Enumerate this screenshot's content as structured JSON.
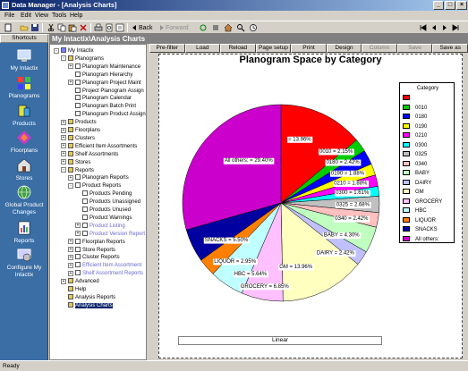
{
  "window": {
    "title": "Data Manager - [Analysis Charts]"
  },
  "menu": [
    "File",
    "Edit",
    "View",
    "Tools",
    "Help"
  ],
  "toolbar": {
    "back_label": "Back",
    "forward_label": "Forward"
  },
  "shortcuts": {
    "header": "Shortcuts",
    "items": [
      {
        "label": "My Intactix",
        "icon": "my-intactix-icon"
      },
      {
        "label": "Planograms",
        "icon": "planograms-icon"
      },
      {
        "label": "Products",
        "icon": "products-icon"
      },
      {
        "label": "Floorplans",
        "icon": "floorplans-icon"
      },
      {
        "label": "Stores",
        "icon": "stores-icon"
      },
      {
        "label": "Global Product Changes",
        "icon": "global-product-changes-icon"
      },
      {
        "label": "Reports",
        "icon": "reports-icon"
      },
      {
        "label": "Configure My Intactix",
        "icon": "configure-icon"
      }
    ]
  },
  "main_header": "My Intactix\\Analysis Charts",
  "tree": [
    {
      "label": "My Intactix",
      "level": 0,
      "expander": "-"
    },
    {
      "label": "Planograms",
      "level": 1,
      "expander": "-"
    },
    {
      "label": "Planogram Maintenance",
      "level": 2,
      "expander": "+"
    },
    {
      "label": "Planogram Hierarchy",
      "level": 2,
      "expander": ""
    },
    {
      "label": "Planogram Project Maint",
      "level": 2,
      "expander": "+"
    },
    {
      "label": "Project Planogram Assign",
      "level": 2,
      "expander": ""
    },
    {
      "label": "Planogram Calendar",
      "level": 2,
      "expander": ""
    },
    {
      "label": "Planogram Batch Print",
      "level": 2,
      "expander": ""
    },
    {
      "label": "Planogram Product Assign",
      "level": 2,
      "expander": ""
    },
    {
      "label": "Products",
      "level": 1,
      "expander": "+"
    },
    {
      "label": "Floorplans",
      "level": 1,
      "expander": "+"
    },
    {
      "label": "Clusters",
      "level": 1,
      "expander": "+"
    },
    {
      "label": "Efficient Item Assortments",
      "level": 1,
      "expander": "+"
    },
    {
      "label": "Shelf Assortments",
      "level": 1,
      "expander": "+"
    },
    {
      "label": "Stores",
      "level": 1,
      "expander": "+"
    },
    {
      "label": "Reports",
      "level": 1,
      "expander": "-"
    },
    {
      "label": "Planogram Reports",
      "level": 2,
      "expander": "+"
    },
    {
      "label": "Product Reports",
      "level": 2,
      "expander": "-"
    },
    {
      "label": "Products Pending",
      "level": 3,
      "expander": ""
    },
    {
      "label": "Products Unassigned",
      "level": 3,
      "expander": ""
    },
    {
      "label": "Products Unused",
      "level": 3,
      "expander": ""
    },
    {
      "label": "Product Warnings",
      "level": 3,
      "expander": ""
    },
    {
      "label": "Product Listing",
      "level": 3,
      "expander": "+",
      "grey": true
    },
    {
      "label": "Product Version Report",
      "level": 3,
      "expander": "+",
      "grey": true
    },
    {
      "label": "Floorplan Reports",
      "level": 2,
      "expander": "+"
    },
    {
      "label": "Store Reports",
      "level": 2,
      "expander": "+"
    },
    {
      "label": "Cluster Reports",
      "level": 2,
      "expander": "+"
    },
    {
      "label": "Efficient Item Assortment",
      "level": 2,
      "expander": "+",
      "grey": true
    },
    {
      "label": "Shelf Assortment Reports",
      "level": 2,
      "expander": "+",
      "grey": true
    },
    {
      "label": "Advanced",
      "level": 1,
      "expander": "+"
    },
    {
      "label": "Help",
      "level": 1,
      "expander": ""
    },
    {
      "label": "Analysis Reports",
      "level": 1,
      "expander": ""
    },
    {
      "label": "Analysis Charts",
      "level": 1,
      "expander": "",
      "selected": true
    }
  ],
  "tabs": [
    {
      "label": "Pre-filter",
      "disabled": false
    },
    {
      "label": "Load",
      "disabled": false
    },
    {
      "label": "Reload",
      "disabled": false
    },
    {
      "label": "Page setup",
      "disabled": false
    },
    {
      "label": "Print",
      "disabled": false
    },
    {
      "label": "Design",
      "disabled": false
    },
    {
      "label": "Column",
      "disabled": true
    },
    {
      "label": "Save",
      "disabled": true
    },
    {
      "label": "Save as",
      "disabled": false
    }
  ],
  "scale_label": "Linear",
  "status": "Ready",
  "colors": {
    "title_bar_start": "#0a246a",
    "shortcut_bg": "#3a6ea5",
    "selection": "#0a246a"
  },
  "chart_data": {
    "type": "pie",
    "title": "Planogram Space by Category",
    "legend_title": "Category",
    "legend_position": "right",
    "slices": [
      {
        "name": "",
        "value": 13.96,
        "label": "= 13.96%",
        "color": "#ff0000"
      },
      {
        "name": "0010",
        "value": 2.15,
        "label": "0010 = 2.15%",
        "color": "#00cc00"
      },
      {
        "name": "0180",
        "value": 2.42,
        "label": "0180 = 2.42%",
        "color": "#0000ff"
      },
      {
        "name": "0190",
        "value": 1.88,
        "label": "0190 = 1.88%",
        "color": "#ffff00"
      },
      {
        "name": "0210",
        "value": 1.88,
        "label": "0210 = 1.88%",
        "color": "#ff00ff"
      },
      {
        "name": "0300",
        "value": 1.61,
        "label": "0300 = 1.61%",
        "color": "#00ffff"
      },
      {
        "name": "0325",
        "value": 2.68,
        "label": "0325 = 2.68%",
        "color": "#c0c0c0"
      },
      {
        "name": "0340",
        "value": 2.42,
        "label": "0340 = 2.42%",
        "color": "#ffc0c0"
      },
      {
        "name": "BABY",
        "value": 4.3,
        "label": "BABY = 4.30%",
        "color": "#c0ffc0"
      },
      {
        "name": "DAIRY",
        "value": 2.42,
        "label": "DAIRY = 2.42%",
        "color": "#c0c0ff"
      },
      {
        "name": "GM",
        "value": 13.96,
        "label": "GM = 13.96%",
        "color": "#ffffc0"
      },
      {
        "name": "GROCERY",
        "value": 6.85,
        "label": "GROCERY = 6.85%",
        "color": "#ffc0ff"
      },
      {
        "name": "HBC",
        "value": 5.64,
        "label": "HBC = 5.64%",
        "color": "#c0ffff"
      },
      {
        "name": "LIQUOR",
        "value": 2.95,
        "label": "LIQUOR = 2.95%",
        "color": "#ff8000"
      },
      {
        "name": "SNACKS",
        "value": 5.5,
        "label": "SNACKS = 5.50%",
        "color": "#0000a0"
      },
      {
        "name": "All others:",
        "value": 29.4,
        "label": "All others: = 29.40%",
        "color": "#cc00cc"
      }
    ]
  }
}
